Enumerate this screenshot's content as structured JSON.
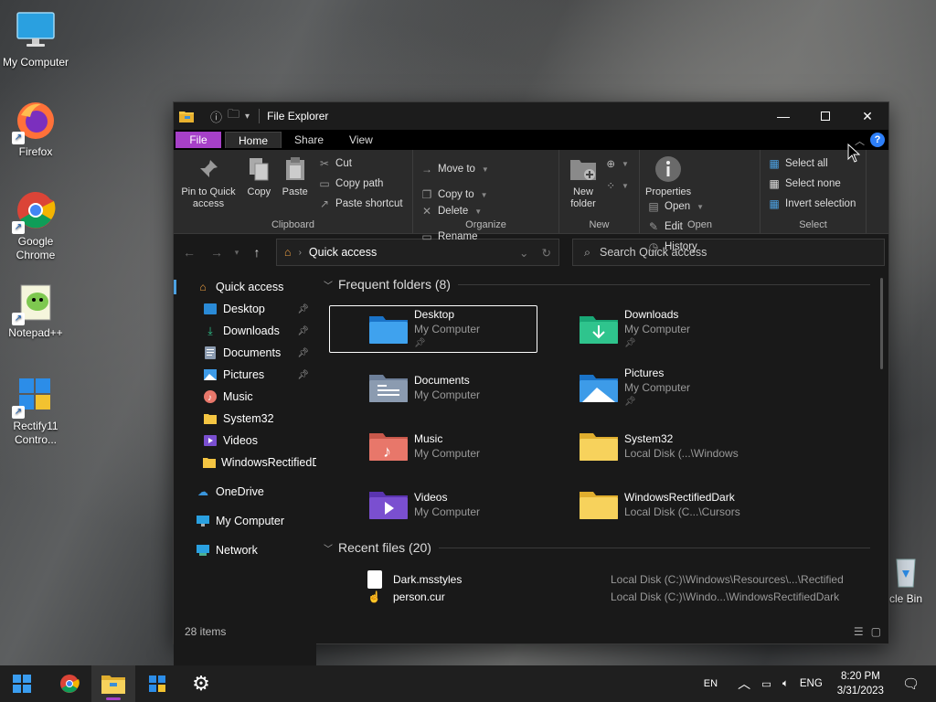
{
  "desktop": {
    "icons": [
      {
        "label": "My Computer"
      },
      {
        "label": "Firefox"
      },
      {
        "label": "Google Chrome"
      },
      {
        "label": "Notepad++"
      },
      {
        "label": "Rectify11 Contro..."
      }
    ],
    "recycle_label": "cle Bin"
  },
  "window": {
    "title": "File Explorer",
    "tabs": {
      "file": "File",
      "home": "Home",
      "share": "Share",
      "view": "View"
    },
    "help": "?"
  },
  "ribbon": {
    "clipboard": {
      "label": "Clipboard",
      "pin": "Pin to Quick access",
      "copy": "Copy",
      "paste": "Paste",
      "cut": "Cut",
      "copy_path": "Copy path",
      "paste_shortcut": "Paste shortcut"
    },
    "organize": {
      "label": "Organize",
      "move_to": "Move to",
      "copy_to": "Copy to",
      "delete": "Delete",
      "rename": "Rename"
    },
    "new": {
      "label": "New",
      "new_folder": "New folder"
    },
    "open": {
      "label": "Open",
      "properties": "Properties",
      "open": "Open",
      "edit": "Edit",
      "history": "History"
    },
    "select": {
      "label": "Select",
      "select_all": "Select all",
      "select_none": "Select none",
      "invert": "Invert selection"
    }
  },
  "address": {
    "location": "Quick access",
    "search_placeholder": "Search Quick access"
  },
  "nav": {
    "quick_access": "Quick access",
    "items": [
      {
        "label": "Desktop",
        "pinned": true
      },
      {
        "label": "Downloads",
        "pinned": true
      },
      {
        "label": "Documents",
        "pinned": true
      },
      {
        "label": "Pictures",
        "pinned": true
      },
      {
        "label": "Music",
        "pinned": false
      },
      {
        "label": "System32",
        "pinned": false
      },
      {
        "label": "Videos",
        "pinned": false
      },
      {
        "label": "WindowsRectifiedD",
        "pinned": false
      }
    ],
    "onedrive": "OneDrive",
    "my_computer": "My Computer",
    "network": "Network"
  },
  "frequent": {
    "header": "Frequent folders (8)",
    "folders": [
      {
        "name": "Desktop",
        "path": "My Computer",
        "pinned": true
      },
      {
        "name": "Downloads",
        "path": "My Computer",
        "pinned": true
      },
      {
        "name": "Documents",
        "path": "My Computer",
        "pinned": false
      },
      {
        "name": "Pictures",
        "path": "My Computer",
        "pinned": true
      },
      {
        "name": "Music",
        "path": "My Computer",
        "pinned": false
      },
      {
        "name": "System32",
        "path": "Local Disk (...\\Windows",
        "pinned": false
      },
      {
        "name": "Videos",
        "path": "My Computer",
        "pinned": false
      },
      {
        "name": "WindowsRectifiedDark",
        "path": "Local Disk (C...\\Cursors",
        "pinned": false
      }
    ]
  },
  "recent": {
    "header": "Recent files (20)",
    "files": [
      {
        "name": "Dark.msstyles",
        "path": "Local Disk (C:)\\Windows\\Resources\\...\\Rectified"
      },
      {
        "name": "person.cur",
        "path": "Local Disk (C:)\\Windo...\\WindowsRectifiedDark"
      }
    ]
  },
  "status": {
    "items": "28 items"
  },
  "taskbar": {
    "lang": "EN",
    "input": "ENG",
    "time": "8:20 PM",
    "date": "3/31/2023"
  },
  "colors": {
    "accent": "#a640c8",
    "window_bg": "#191919",
    "ribbon_bg": "#2b2b2b",
    "help": "#2d7ff9"
  }
}
